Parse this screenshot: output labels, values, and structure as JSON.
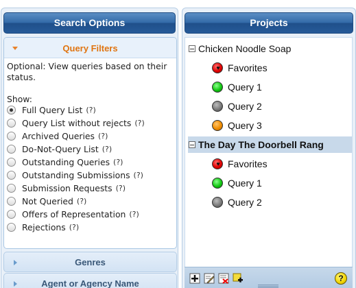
{
  "search_options": {
    "title": "Search Options",
    "query_filters": {
      "title": "Query Filters",
      "description": "Optional: View queries based on their status.",
      "show_label": "Show:",
      "options": [
        {
          "label": "Full Query List",
          "help": "(?)",
          "checked": true
        },
        {
          "label": "Query List without rejects",
          "help": "(?)",
          "checked": false
        },
        {
          "label": "Archived Queries",
          "help": "(?)",
          "checked": false
        },
        {
          "label": "Do-Not-Query List",
          "help": "(?)",
          "checked": false
        },
        {
          "label": "Outstanding Queries",
          "help": "(?)",
          "checked": false
        },
        {
          "label": "Outstanding Submissions",
          "help": "(?)",
          "checked": false
        },
        {
          "label": "Submission Requests",
          "help": "(?)",
          "checked": false
        },
        {
          "label": "Not Queried",
          "help": "(?)",
          "checked": false
        },
        {
          "label": "Offers of Representation",
          "help": "(?)",
          "checked": false
        },
        {
          "label": "Rejections",
          "help": "(?)",
          "checked": false
        }
      ]
    },
    "genres": {
      "title": "Genres"
    },
    "agent_or_agency": {
      "title": "Agent or Agency Name"
    }
  },
  "projects": {
    "title": "Projects",
    "items": [
      {
        "name": "Chicken Noodle Soap",
        "selected": false,
        "children": [
          {
            "label": "Favorites",
            "color": "red"
          },
          {
            "label": "Query 1",
            "color": "green"
          },
          {
            "label": "Query 2",
            "color": "gray"
          },
          {
            "label": "Query 3",
            "color": "orange"
          }
        ]
      },
      {
        "name": "The Day The Doorbell Rang",
        "selected": true,
        "children": [
          {
            "label": "Favorites",
            "color": "red"
          },
          {
            "label": "Query 1",
            "color": "green"
          },
          {
            "label": "Query 2",
            "color": "gray"
          }
        ]
      }
    ],
    "toolbar": {
      "help": "?",
      "buttons": [
        "add-icon",
        "edit-icon",
        "delete-icon",
        "add-folder-icon"
      ]
    }
  },
  "colors": {
    "header_blue": "#336aa8",
    "accent_orange": "#e07410",
    "selection": "#c8d9ea"
  }
}
